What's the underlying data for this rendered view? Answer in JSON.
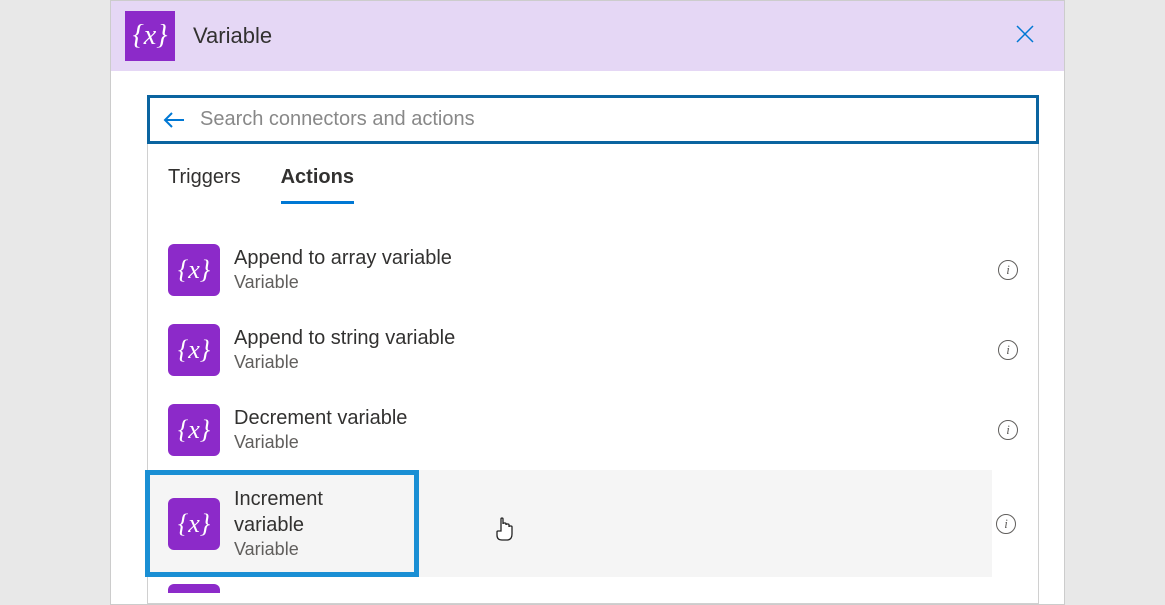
{
  "header": {
    "title": "Variable",
    "icon_glyph": "{x}"
  },
  "search": {
    "placeholder": "Search connectors and actions"
  },
  "tabs": [
    {
      "label": "Triggers",
      "active": false
    },
    {
      "label": "Actions",
      "active": true
    }
  ],
  "actions": [
    {
      "title": "Append to array variable",
      "category": "Variable"
    },
    {
      "title": "Append to string variable",
      "category": "Variable"
    },
    {
      "title": "Decrement variable",
      "category": "Variable"
    },
    {
      "title": "Increment variable",
      "category": "Variable"
    }
  ],
  "icon_glyph": "{x}"
}
